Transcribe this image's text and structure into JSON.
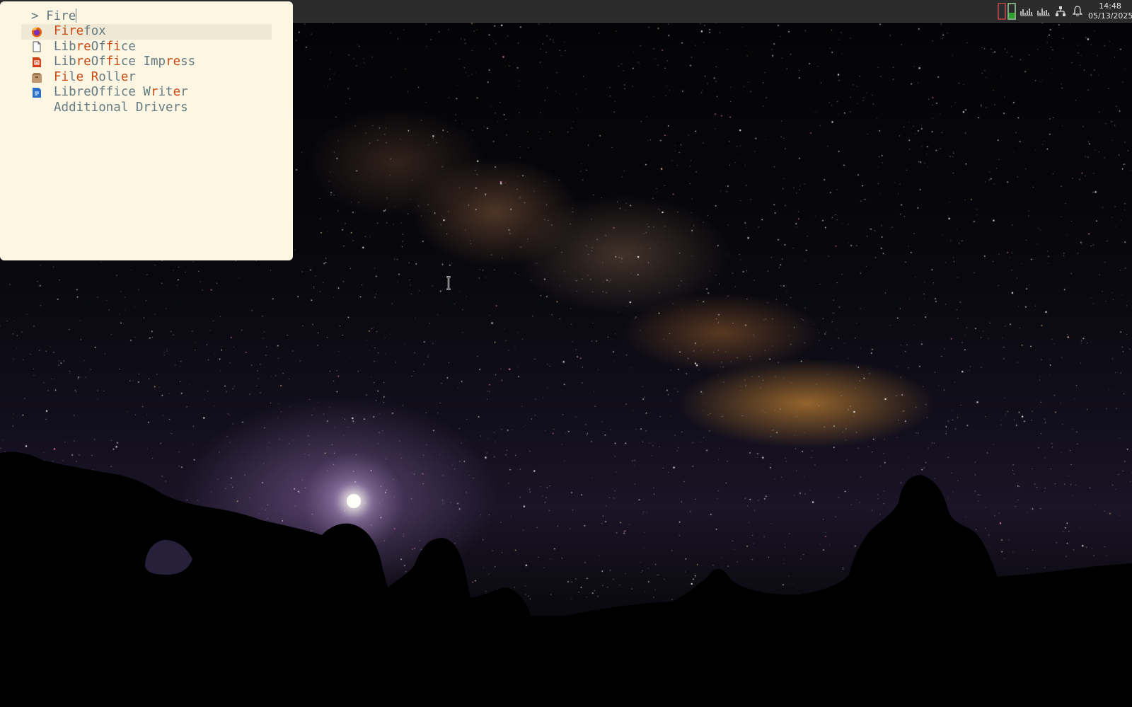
{
  "launcher": {
    "prompt_symbol": ">",
    "query": "Fire",
    "results": [
      {
        "name": "Firefox",
        "icon": "firefox-icon",
        "selected": true,
        "segments": [
          {
            "t": "Fire",
            "m": true
          },
          {
            "t": "fox",
            "m": false
          }
        ]
      },
      {
        "name": "LibreOffice",
        "icon": "libreoffice-icon",
        "selected": false,
        "segments": [
          {
            "t": "Lib",
            "m": false
          },
          {
            "t": "re",
            "m": true
          },
          {
            "t": "Of",
            "m": false
          },
          {
            "t": "fi",
            "m": true
          },
          {
            "t": "ce",
            "m": false
          }
        ]
      },
      {
        "name": "LibreOffice Impress",
        "icon": "libreoffice-impress-icon",
        "selected": false,
        "segments": [
          {
            "t": "Lib",
            "m": false
          },
          {
            "t": "re",
            "m": true
          },
          {
            "t": "Of",
            "m": false
          },
          {
            "t": "fi",
            "m": true
          },
          {
            "t": "ce Imp",
            "m": false
          },
          {
            "t": "re",
            "m": true
          },
          {
            "t": "ss",
            "m": false
          }
        ]
      },
      {
        "name": "File Roller",
        "icon": "file-roller-icon",
        "selected": false,
        "segments": [
          {
            "t": "Fi",
            "m": true
          },
          {
            "t": "l",
            "m": false
          },
          {
            "t": "e",
            "m": true
          },
          {
            "t": " ",
            "m": false
          },
          {
            "t": "R",
            "m": true
          },
          {
            "t": "oll",
            "m": false
          },
          {
            "t": "e",
            "m": true
          },
          {
            "t": "r",
            "m": false
          }
        ]
      },
      {
        "name": "LibreOffice Writer",
        "icon": "libreoffice-writer-icon",
        "selected": false,
        "segments": [
          {
            "t": "LibreOffice W",
            "m": false
          },
          {
            "t": "r",
            "m": true
          },
          {
            "t": "it",
            "m": false
          },
          {
            "t": "e",
            "m": true
          },
          {
            "t": "r",
            "m": false
          }
        ]
      },
      {
        "name": "Additional Drivers",
        "icon": "",
        "selected": false,
        "segments": [
          {
            "t": "Additional Drivers",
            "m": false
          }
        ]
      }
    ]
  },
  "panel": {
    "time": "14:48",
    "date": "05/13/2025",
    "tray_icons": [
      "workspace-indicator-icon",
      "network-speed-icon",
      "network-speed-icon-2",
      "network-icon",
      "notification-bell-icon"
    ]
  },
  "colors": {
    "launcher_bg": "#fdf6e3",
    "selected_bg": "#eee8d5",
    "text": "#657b83",
    "match": "#cb4b16",
    "panel_bg": "#2b2b2b"
  }
}
